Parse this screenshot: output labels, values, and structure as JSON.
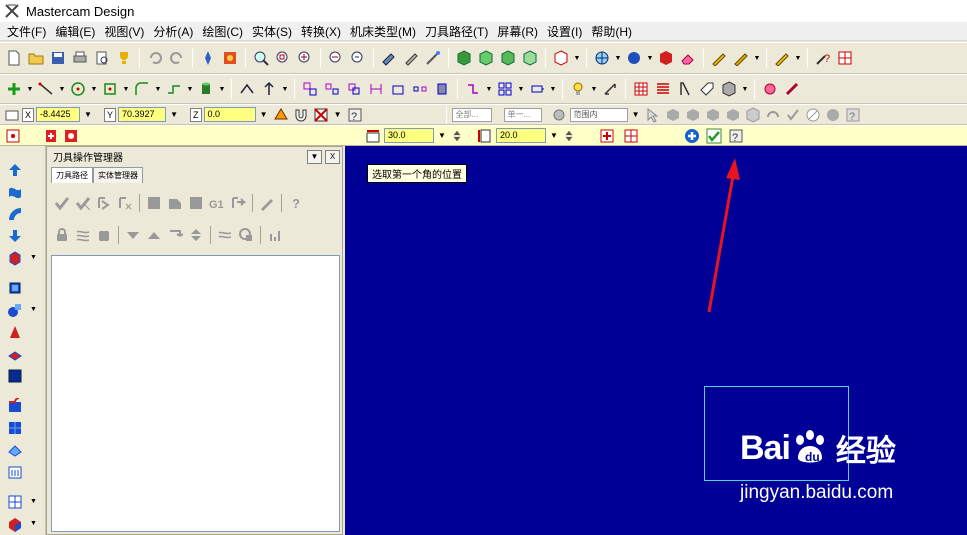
{
  "window": {
    "title": "Mastercam Design",
    "icon": "mastercam-logo-icon"
  },
  "menu": [
    "文件(F)",
    "编辑(E)",
    "视图(V)",
    "分析(A)",
    "绘图(C)",
    "实体(S)",
    "转换(X)",
    "机床类型(M)",
    "刀具路径(T)",
    "屏幕(R)",
    "设置(I)",
    "帮助(H)"
  ],
  "coords": {
    "x_label": "X",
    "x_value": "-8.4425",
    "y_label": "Y",
    "y_value": "70.3927",
    "z_label": "Z",
    "z_value": "0.0"
  },
  "select_bar": {
    "mode1": "全部...",
    "mode2": "单一...",
    "range": "范围内"
  },
  "ribbon": {
    "width_value": "30.0",
    "height_value": "20.0"
  },
  "ops_manager": {
    "title": "刀具操作管理器",
    "tab_toolpaths": "刀具路径",
    "tab_solids": "实体管理器",
    "g1_label": "G1",
    "min_label": "▼",
    "close_label": "X"
  },
  "viewport": {
    "prompt": "选取第一个角的位置",
    "background": "#000096",
    "selection_color": "#4fd3e0",
    "annotation_color": "#e8141e"
  },
  "watermark": {
    "brand": "Bai",
    "brand2": "经验",
    "url": "jingyan.baidu.com"
  }
}
